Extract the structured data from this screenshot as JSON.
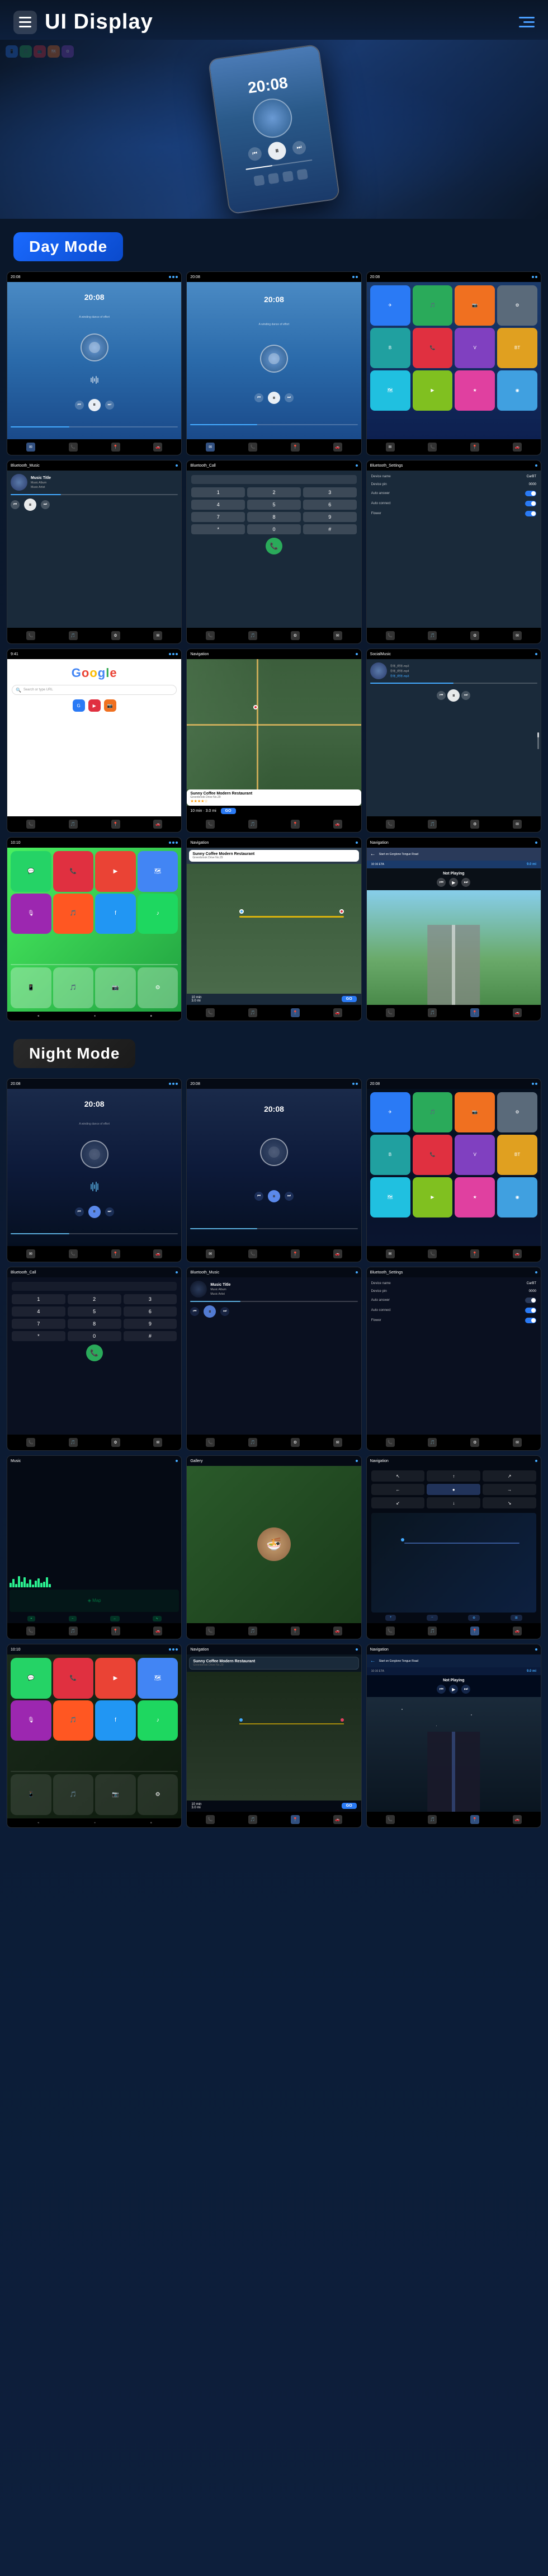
{
  "header": {
    "title": "UI Display",
    "menu_icon_label": "menu",
    "hamburger_label": "hamburger"
  },
  "sections": {
    "day_mode": {
      "label": "Day Mode"
    },
    "night_mode": {
      "label": "Night Mode"
    }
  },
  "screens": {
    "time": "20:08",
    "subtitle": "A winding dance of effort",
    "music_title": "Music Title",
    "music_album": "Music Album",
    "music_artist": "Music Artist",
    "bluetooth_music": "Bluetooth_Music",
    "bluetooth_call": "Bluetooth_Call",
    "bluetooth_settings": "Bluetooth_Settings",
    "device_name": "Device name",
    "device_name_val": "CarBT",
    "device_pin": "Device pin",
    "device_pin_val": "0000",
    "auto_answer": "Auto answer",
    "auto_connect": "Auto connect",
    "flower": "Flower",
    "local_music": "SocialMusic",
    "dial_buttons": [
      "1",
      "2",
      "3",
      "4",
      "5",
      "6",
      "7",
      "8",
      "9",
      "*",
      "0",
      "#"
    ],
    "google": "Google",
    "sunny_coffee": "Sunny Coffee\nModern Restaurant",
    "sunny_addr": "Greenbrook Drive No.29",
    "eta_label": "10 min",
    "eta_dist": "3.0 mi",
    "go_label": "GO",
    "not_playing": "Not Playing",
    "start_on": "Start on\nGorglone\nTongue Road",
    "navigation_title": "Navigation",
    "night_eq_heights": [
      8,
      12,
      6,
      15,
      10,
      18,
      8,
      14,
      6,
      12,
      16,
      8,
      10,
      14,
      7
    ],
    "day_eq_heights": [
      6,
      10,
      8,
      14,
      7,
      16,
      6,
      12,
      5,
      10,
      14,
      7,
      9,
      12,
      5
    ]
  }
}
